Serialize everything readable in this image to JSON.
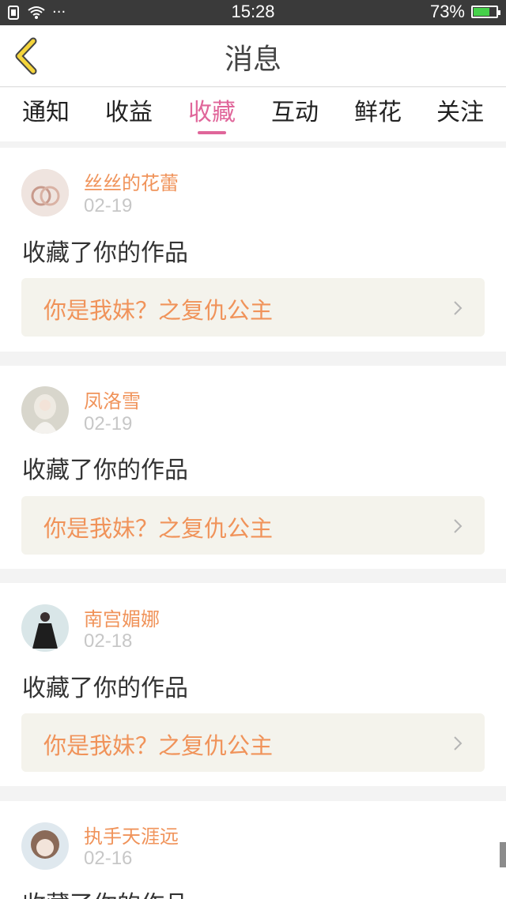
{
  "status_bar": {
    "time": "15:28",
    "battery_percent": "73%",
    "battery_level": 0.73,
    "left_dots": "···"
  },
  "header": {
    "title": "消息"
  },
  "tabs": [
    {
      "label": "通知",
      "active": false
    },
    {
      "label": "收益",
      "active": false
    },
    {
      "label": "收藏",
      "active": true
    },
    {
      "label": "互动",
      "active": false
    },
    {
      "label": "鲜花",
      "active": false
    },
    {
      "label": "关注",
      "active": false
    }
  ],
  "messages": [
    {
      "user": "丝丝的花蕾",
      "date": "02-19",
      "action": "收藏了你的作品",
      "work": "你是我妹？之复仇公主"
    },
    {
      "user": "凤洛雪",
      "date": "02-19",
      "action": "收藏了你的作品",
      "work": "你是我妹？之复仇公主"
    },
    {
      "user": "南宫媚娜",
      "date": "02-18",
      "action": "收藏了你的作品",
      "work": "你是我妹？之复仇公主"
    },
    {
      "user": "执手天涯远",
      "date": "02-16",
      "action": "收藏了你的作品",
      "work": ""
    }
  ],
  "colors": {
    "accent": "#e0669a",
    "name": "#f0935a",
    "date": "#c7c7c7",
    "work_bg": "#f4f3ec",
    "back_arrow": "#f5d53b"
  }
}
